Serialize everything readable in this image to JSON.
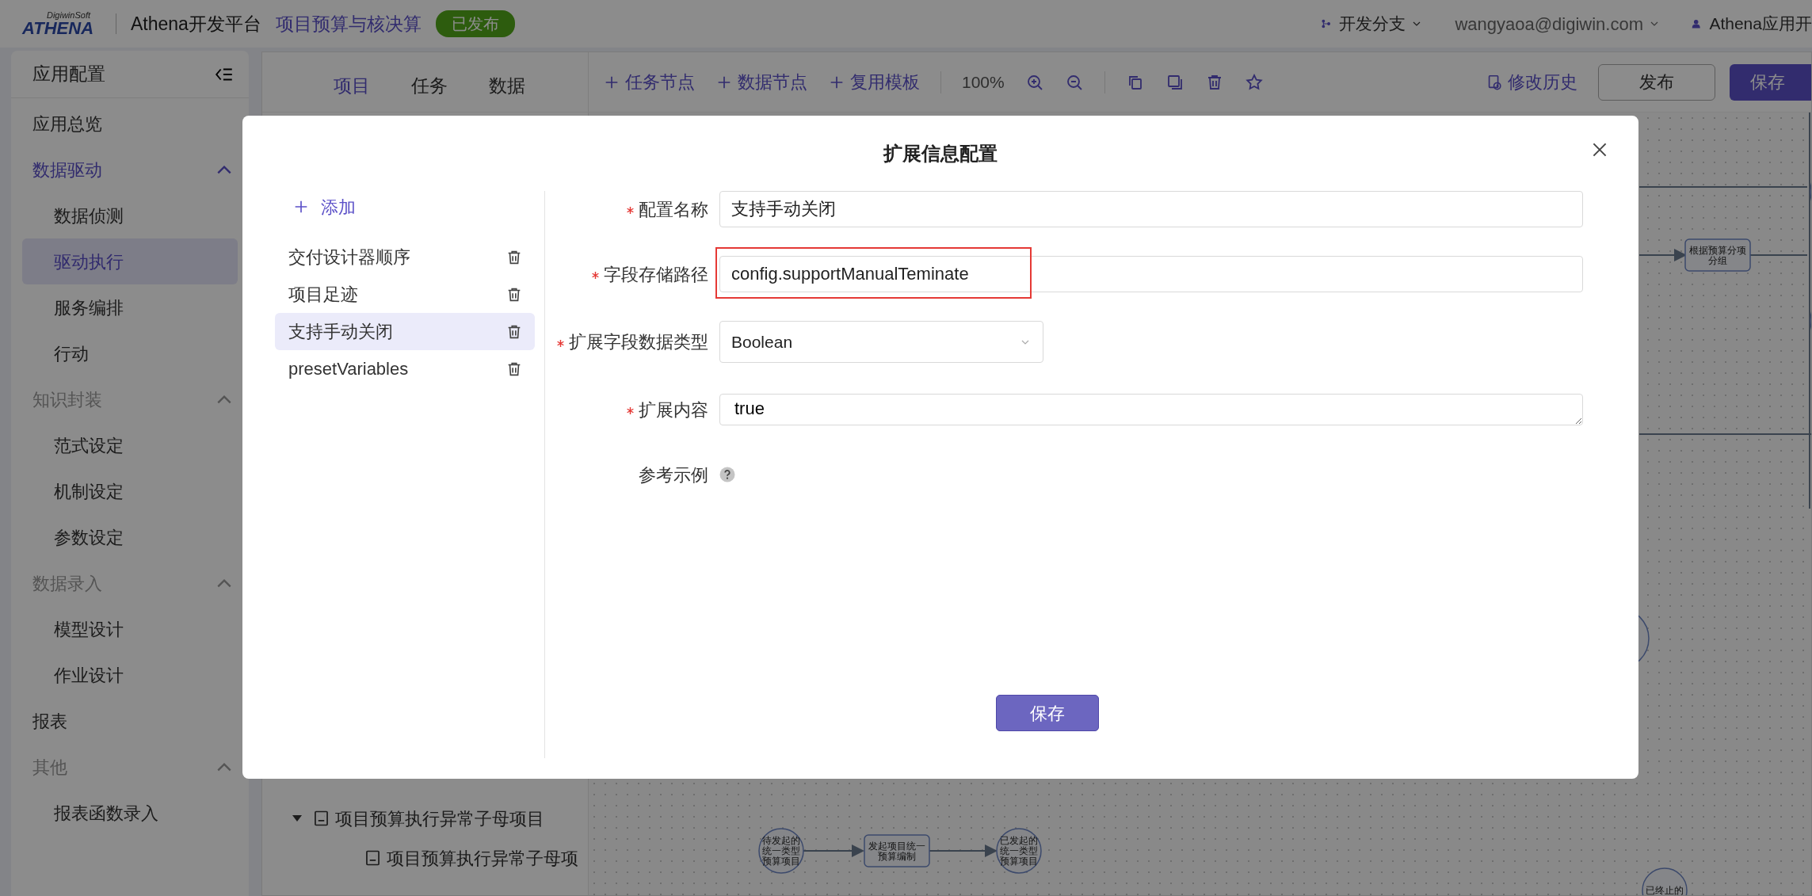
{
  "top_bar": {
    "logo_top": "DigiwinSoft",
    "logo_main": "ATHENA",
    "brand": "Athena开发平台",
    "project": "项目预算与核决算",
    "status_badge": "已发布",
    "branch": "开发分支",
    "user_email": "wangyaoa@digiwin.com",
    "app_name": "Athena应用开"
  },
  "sidebar": {
    "title": "应用配置",
    "items": [
      {
        "kind": "link",
        "label": "应用总览"
      },
      {
        "kind": "group",
        "label": "数据驱动",
        "active": true,
        "expanded": true,
        "children": [
          {
            "label": "数据侦测",
            "selected": false
          },
          {
            "label": "驱动执行",
            "selected": true
          },
          {
            "label": "服务编排",
            "selected": false
          },
          {
            "label": "行动",
            "selected": false
          }
        ]
      },
      {
        "kind": "group",
        "label": "知识封装",
        "active": false,
        "expanded": true,
        "children": [
          {
            "label": "范式设定",
            "selected": false
          },
          {
            "label": "机制设定",
            "selected": false
          },
          {
            "label": "参数设定",
            "selected": false
          }
        ]
      },
      {
        "kind": "group",
        "label": "数据录入",
        "active": false,
        "expanded": true,
        "children": [
          {
            "label": "模型设计",
            "selected": false
          },
          {
            "label": "作业设计",
            "selected": false
          }
        ]
      },
      {
        "kind": "link",
        "label": "报表"
      },
      {
        "kind": "group",
        "label": "其他",
        "active": false,
        "expanded": true,
        "children": [
          {
            "label": "报表函数录入",
            "selected": false
          }
        ]
      }
    ]
  },
  "tabs": [
    {
      "label": "项目",
      "selected": true
    },
    {
      "label": "任务",
      "selected": false
    },
    {
      "label": "数据",
      "selected": false
    }
  ],
  "toolbar": {
    "add_actions": [
      "任务节点",
      "数据节点",
      "复用模板"
    ],
    "zoom": "100%",
    "history": "修改历史",
    "publish": "发布",
    "save": "保存"
  },
  "tree": [
    {
      "label": "项目预算执行异常子母项目",
      "expanded": true,
      "children": [
        {
          "label": "项目预算执行异常子母项"
        }
      ]
    }
  ],
  "canvas_nodes": [
    {
      "kind": "state",
      "label": "待发起的统一类型预算项目"
    },
    {
      "kind": "task",
      "label": "发起项目统一预算编制"
    },
    {
      "kind": "state",
      "label": "已发起的统一类型预算项目"
    },
    {
      "kind": "task",
      "label": "根据预算分项分组"
    },
    {
      "kind": "state",
      "label": "已终止的"
    }
  ],
  "modal": {
    "title": "扩展信息配置",
    "add_label": "添加",
    "items": [
      {
        "label": "交付设计器顺序",
        "selected": false
      },
      {
        "label": "项目足迹",
        "selected": false
      },
      {
        "label": "支持手动关闭",
        "selected": true
      },
      {
        "label": "presetVariables",
        "selected": false
      }
    ],
    "fields": [
      {
        "kind": "text",
        "label": "配置名称",
        "required": true,
        "value": "支持手动关闭"
      },
      {
        "kind": "text",
        "label": "字段存储路径",
        "required": true,
        "value": "config.supportManualTeminate",
        "highlighted": true
      },
      {
        "kind": "select",
        "label": "扩展字段数据类型",
        "required": true,
        "value": "Boolean"
      },
      {
        "kind": "textarea",
        "label": "扩展内容",
        "required": true,
        "value": "true"
      },
      {
        "kind": "help",
        "label": "参考示例"
      }
    ],
    "save_button": "保存"
  }
}
